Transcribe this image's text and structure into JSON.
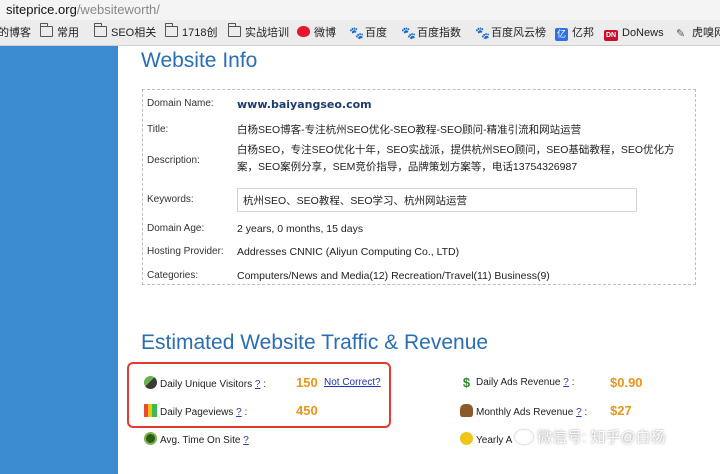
{
  "browser": {
    "url_host": "siteprice.org",
    "url_path": "/websiteworth/"
  },
  "bookmarks": [
    {
      "label": "的博客",
      "icon": "none"
    },
    {
      "label": "常用",
      "icon": "folder-icon"
    },
    {
      "label": "SEO相关",
      "icon": "folder-icon"
    },
    {
      "label": "1718创",
      "icon": "folder-icon"
    },
    {
      "label": "实战培训",
      "icon": "folder-icon"
    },
    {
      "label": "微博",
      "icon": "weibo-icon"
    },
    {
      "label": "百度",
      "icon": "baidu-paw-icon"
    },
    {
      "label": "百度指数",
      "icon": "baidu-paw-icon"
    },
    {
      "label": "百度风云榜",
      "icon": "baidu-paw-icon"
    },
    {
      "label": "亿邦",
      "icon": "yibang-icon"
    },
    {
      "label": "DoNews",
      "icon": "donews-icon"
    },
    {
      "label": "虎嗅网",
      "icon": "huxiu-icon"
    }
  ],
  "info": {
    "heading": "Website Info",
    "domain_label": "Domain Name:",
    "domain_value": "www.baiyangseo.com",
    "title_label": "Title:",
    "title_value": "白杨SEO博客-专注杭州SEO优化-SEO教程-SEO顾问-精准引流和网站运营",
    "description_label": "Description:",
    "description_value": "白杨SEO，专注SEO优化十年，SEO实战派，提供杭州SEO顾问，SEO基础教程，SEO优化方案，SEO案例分享，SEM竞价指导，品牌策划方案等，电话13754326987",
    "keywords_label": "Keywords:",
    "keywords_value": "杭州SEO、SEO教程、SEO学习、杭州网站运营",
    "age_label": "Domain Age:",
    "age_value": "2 years, 0 months, 15 days",
    "hosting_label": "Hosting Provider:",
    "hosting_value": "Addresses CNNIC (Aliyun Computing Co., LTD)",
    "categories_label": "Categories:",
    "categories_value": "Computers/News and Media(12) Recreation/Travel(11) Business(9)"
  },
  "traffic": {
    "heading": "Estimated Website Traffic & Revenue",
    "question": "?",
    "visitors_label": "Daily Unique Visitors",
    "visitors_value": "150",
    "not_correct": "Not Correct?",
    "pageviews_label": "Daily Pageviews",
    "pageviews_value": "450",
    "time_label": "Avg. Time On Site",
    "ads_daily_label": "Daily Ads Revenue",
    "ads_daily_value": "$0.90",
    "ads_monthly_label": "Monthly Ads Revenue",
    "ads_monthly_value": "$27",
    "yearly_label": "Yearly A",
    "colon": ":"
  },
  "watermark": {
    "text": "微信号: 知乎@白杨"
  },
  "colors": {
    "heading": "#2a6db5",
    "value_orange": "#e8961a",
    "highlight_red": "#e53935",
    "page_bg": "#3a8bd0"
  }
}
